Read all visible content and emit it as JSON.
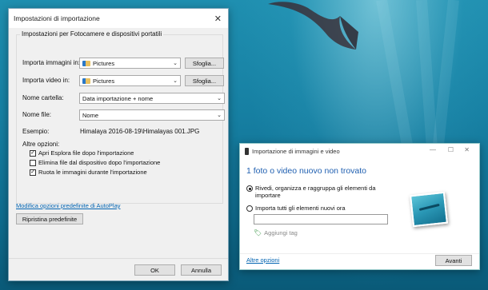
{
  "import_dialog": {
    "title": "Impostazioni di importazione",
    "close_glyph": "✕",
    "group_title": "Impostazioni per Fotocamere e dispositivi portatili",
    "import_images_label": "Importa immagini in:",
    "import_images_value": "Pictures",
    "import_videos_label": "Importa video in:",
    "import_videos_value": "Pictures",
    "browse_label": "Sfoglia...",
    "folder_name_label": "Nome cartella:",
    "folder_name_value": "Data importazione + nome",
    "file_name_label": "Nome file:",
    "file_name_value": "Nome",
    "example_label": "Esempio:",
    "example_value": "Himalaya 2016-08-19\\Himalayas 001.JPG",
    "other_options_label": "Altre opzioni:",
    "options": [
      {
        "label": "Apri Esplora file dopo l'importazione",
        "checked": true
      },
      {
        "label": "Elimina file dal dispositivo dopo l'importazione",
        "checked": false
      },
      {
        "label": "Ruota le immagini durante l'importazione",
        "checked": true
      }
    ],
    "autoplay_link": "Modifica opzioni predefinite di AutoPlay",
    "restore_button": "Ripristina predefinite",
    "ok_button": "OK",
    "cancel_button": "Annulla"
  },
  "autoplay_dialog": {
    "title": "Importazione di immagini e video",
    "minimize_glyph": "—",
    "maximize_glyph": "☐",
    "close_glyph": "✕",
    "heading": "1 foto o video nuovo non trovato",
    "option_review": "Rivedi, organizza e raggruppa gli elementi da importare",
    "option_import_all": "Importa tutti gli elementi nuovi ora",
    "add_tags": "Aggiungi tag",
    "more_options_link": "Altre opzioni",
    "next_button": "Avanti"
  },
  "icons": {
    "check": "✓",
    "dropdown": "⌄",
    "tag": "🏷"
  },
  "colors": {
    "link": "#0063b1",
    "heading": "#1f5fb0"
  }
}
